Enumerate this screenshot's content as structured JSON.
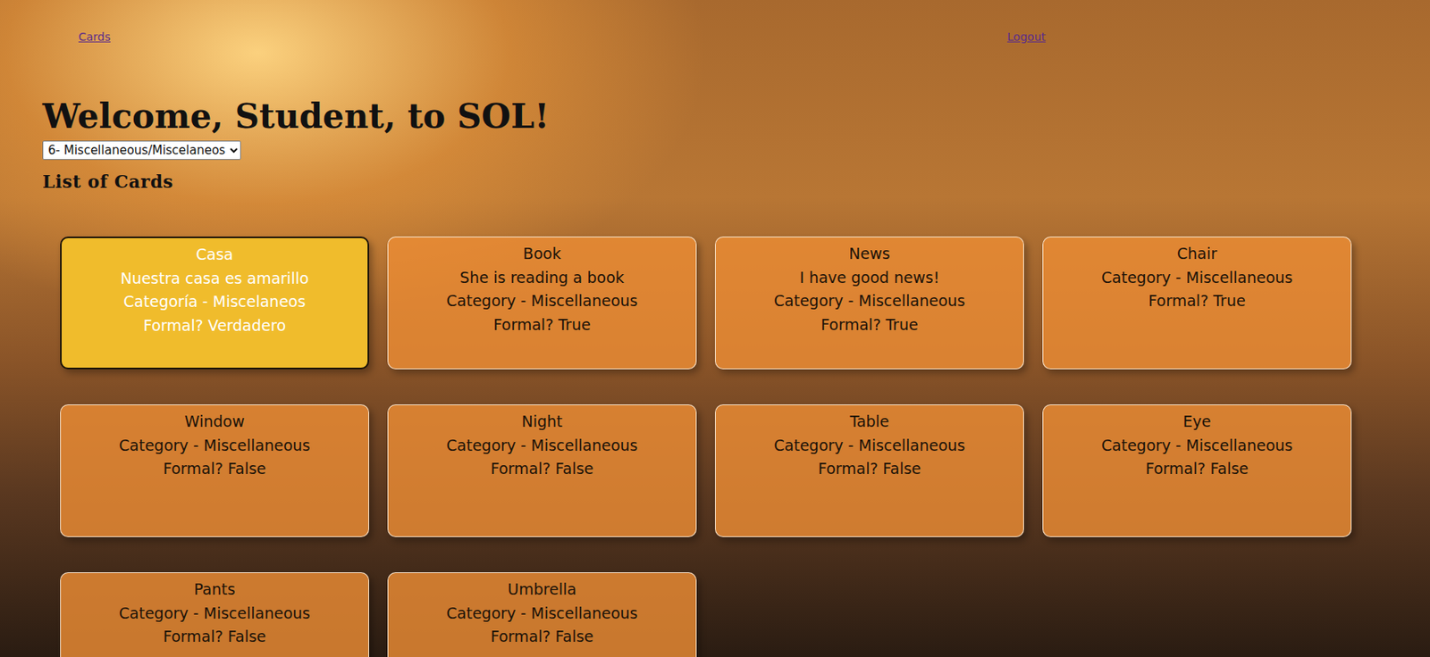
{
  "nav": {
    "left": "Cards",
    "right": "Logout"
  },
  "title": "Welcome, Student, to SOL!",
  "category_select": {
    "value": "6- Miscellaneous/Miscelaneos"
  },
  "list_heading": "List of Cards",
  "cards": [
    {
      "lines": [
        "Casa",
        "Nuestra casa es amarillo",
        "Categoría - Miscelaneos",
        "Formal? Verdadero"
      ],
      "selected": true
    },
    {
      "lines": [
        "Book",
        "She is reading a book",
        "Category - Miscellaneous",
        "Formal? True"
      ],
      "selected": false
    },
    {
      "lines": [
        "News",
        "I have good news!",
        "Category - Miscellaneous",
        "Formal? True"
      ],
      "selected": false
    },
    {
      "lines": [
        "Chair",
        "Category - Miscellaneous",
        "Formal? True"
      ],
      "selected": false
    },
    {
      "lines": [
        "Window",
        "Category - Miscellaneous",
        "Formal? False"
      ],
      "selected": false
    },
    {
      "lines": [
        "Night",
        "Category - Miscellaneous",
        "Formal? False"
      ],
      "selected": false
    },
    {
      "lines": [
        "Table",
        "Category - Miscellaneous",
        "Formal? False"
      ],
      "selected": false
    },
    {
      "lines": [
        "Eye",
        "Category - Miscellaneous",
        "Formal? False"
      ],
      "selected": false
    },
    {
      "lines": [
        "Pants",
        "Category - Miscellaneous",
        "Formal? False"
      ],
      "selected": false
    },
    {
      "lines": [
        "Umbrella",
        "Category - Miscellaneous",
        "Formal? False"
      ],
      "selected": false
    }
  ]
}
